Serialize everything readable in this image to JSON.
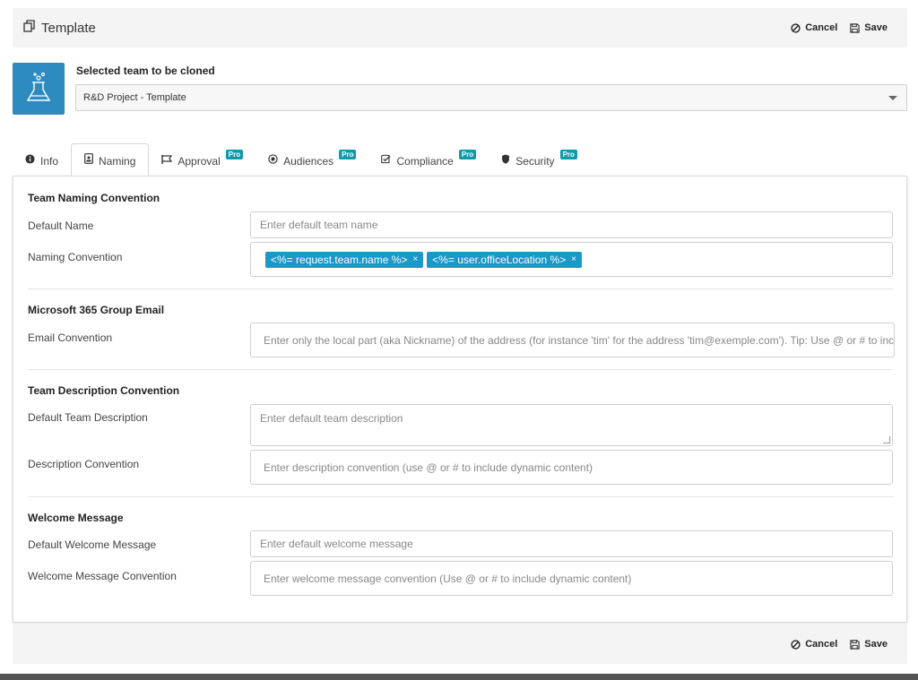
{
  "header": {
    "title": "Template",
    "cancel_label": "Cancel",
    "save_label": "Save"
  },
  "clone": {
    "label": "Selected team to be cloned",
    "selected": "R&D Project - Template"
  },
  "tabs": [
    {
      "label": "Info",
      "icon": "info-icon",
      "pro": ""
    },
    {
      "label": "Naming",
      "icon": "id-badge-icon",
      "pro": ""
    },
    {
      "label": "Approval",
      "icon": "flag-icon",
      "pro": "Pro"
    },
    {
      "label": "Audiences",
      "icon": "dot-circle-icon",
      "pro": "Pro"
    },
    {
      "label": "Compliance",
      "icon": "check-square-icon",
      "pro": "Pro"
    },
    {
      "label": "Security",
      "icon": "shield-icon",
      "pro": "Pro"
    }
  ],
  "active_tab": "Naming",
  "sections": {
    "team_naming": {
      "title": "Team Naming Convention",
      "default_name_label": "Default Name",
      "default_name_placeholder": "Enter default team name",
      "naming_convention_label": "Naming Convention",
      "tags": [
        "<%= request.team.name %>",
        "<%= user.officeLocation %>"
      ],
      "tag_remove": "×"
    },
    "group_email": {
      "title": "Microsoft 365 Group Email",
      "email_label": "Email Convention",
      "email_placeholder": "Enter only the local part (aka Nickname) of the address (for instance 'tim' for the address 'tim@exemple.com'). Tip: Use @ or # to include dynamic content"
    },
    "description": {
      "title": "Team Description Convention",
      "default_label": "Default Team Description",
      "default_placeholder": "Enter default team description",
      "convention_label": "Description Convention",
      "convention_placeholder": "Enter description convention (use @ or # to include dynamic content)"
    },
    "welcome": {
      "title": "Welcome Message",
      "default_label": "Default Welcome Message",
      "default_placeholder": "Enter default welcome message",
      "convention_label": "Welcome Message Convention",
      "convention_placeholder": "Enter welcome message convention (Use @ or # to include dynamic content)"
    }
  },
  "footer": {
    "cancel_label": "Cancel",
    "save_label": "Save"
  },
  "colors": {
    "accent": "#1a98c7",
    "pro_badge": "#1199aa",
    "logo_bg": "#2e8bc0"
  }
}
